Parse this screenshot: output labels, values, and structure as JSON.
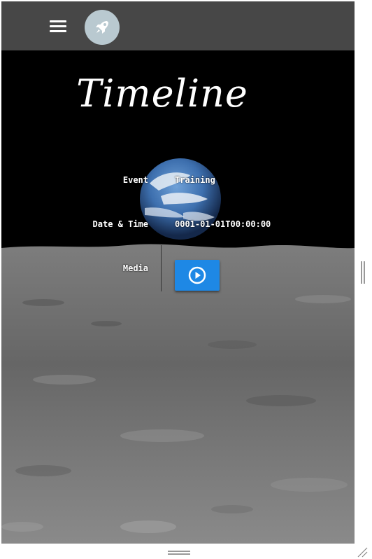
{
  "header": {
    "menu_icon": "hamburger-menu-icon",
    "logo_icon": "rocket-icon"
  },
  "page": {
    "title": "Timeline"
  },
  "details": {
    "event_label": "Event",
    "event_value": "Training",
    "datetime_label": "Date & Time",
    "datetime_value": "0001-01-01T00:00:00",
    "media_label": "Media",
    "media_icon": "play-circle-icon"
  },
  "colors": {
    "topbar": "#474747",
    "logo_bg": "#b9c9d0",
    "play_button": "#1e88e5"
  }
}
